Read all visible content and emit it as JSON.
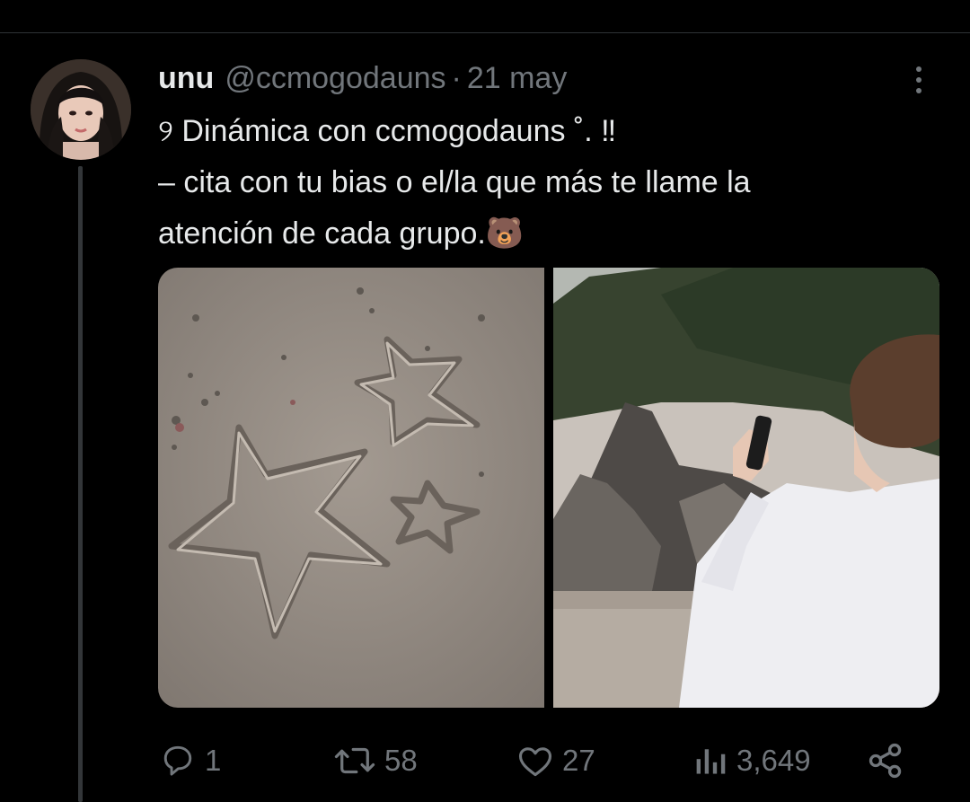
{
  "tweet": {
    "display_name": "unu",
    "handle": "@ccmogodauns",
    "separator": "·",
    "time": "21 may",
    "text_lines": [
      "୨ Dinámica con ccmogodauns ˚. ‼",
      "– cita con tu bias o el/la que más te llame la",
      "atención de cada grupo.🐻"
    ]
  },
  "media": {
    "items": [
      {
        "description_icon": "sand-stars-photo"
      },
      {
        "description_icon": "beach-person-photo"
      }
    ]
  },
  "actions": {
    "reply_count": "1",
    "retweet_count": "58",
    "like_count": "27",
    "views_count": "3,649"
  },
  "icons": {
    "reply": "reply-icon",
    "retweet": "retweet-icon",
    "like": "heart-icon",
    "views": "views-icon",
    "share": "share-icon",
    "more": "more-icon"
  },
  "colors": {
    "background": "#000000",
    "text_primary": "#e7e9ea",
    "text_secondary": "#71767b",
    "divider": "#2f3336"
  }
}
